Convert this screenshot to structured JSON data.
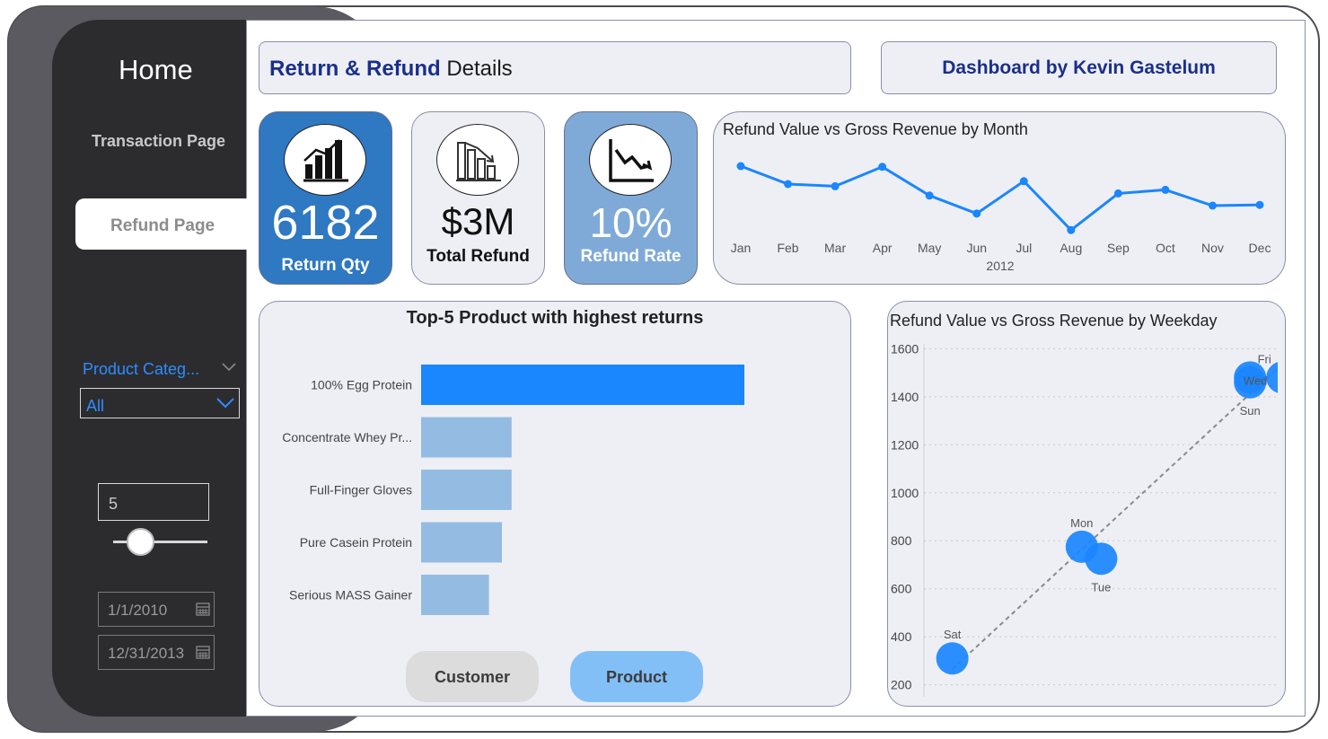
{
  "nav": {
    "home": "Home",
    "transaction": "Transaction Page",
    "refund": "Refund Page"
  },
  "filters": {
    "category_title": "Product Categ...",
    "category_value": "All",
    "top_n": "5",
    "top_n_slider_fraction": 0.15,
    "date_start": "1/1/2010",
    "date_end": "12/31/2013"
  },
  "header": {
    "title_bold": "Return & Refund",
    "title_rest": " Details",
    "byline": "Dashboard by Kevin Gastelum"
  },
  "kpis": [
    {
      "value": "6182",
      "label": "Return Qty",
      "icon": "bar-chart-icon"
    },
    {
      "value": "$3M",
      "label": "Total Refund",
      "icon": "declining-bars-icon"
    },
    {
      "value": "10%",
      "label": "Refund Rate",
      "icon": "downtrend-icon"
    }
  ],
  "toggles": {
    "customer": "Customer",
    "product": "Product"
  },
  "colors": {
    "accent": "#1a86ff",
    "bar_muted": "#94bce2",
    "navy": "#1a2f8c",
    "sidebar": "#2c2c2e"
  },
  "chart_data": [
    {
      "type": "line",
      "title": "Refund Value vs Gross Revenue by Month",
      "x": [
        "Jan",
        "Feb",
        "Mar",
        "Apr",
        "May",
        "Jun",
        "Jul",
        "Aug",
        "Sep",
        "Oct",
        "Nov",
        "Dec"
      ],
      "x_group_label": "2012",
      "values": [
        0.9,
        0.65,
        0.62,
        0.89,
        0.49,
        0.24,
        0.69,
        0.01,
        0.52,
        0.57,
        0.35,
        0.36
      ],
      "ylim": [
        0,
        1
      ],
      "grid": false
    },
    {
      "type": "bar",
      "title": "Top-5 Product with highest returns",
      "categories": [
        "100% Egg Protein",
        "Concentrate Whey Pr...",
        "Full-Finger Gloves",
        "Pure Casein Protein",
        "Serious MASS Gainer"
      ],
      "values": [
        100,
        28,
        28,
        25,
        21
      ],
      "highlight_index": 0
    },
    {
      "type": "scatter",
      "title": "Refund Value vs Gross Revenue by Weekday",
      "points": [
        {
          "label": "Sat",
          "x": 0.0,
          "y": 310
        },
        {
          "label": "Mon",
          "x": 0.4,
          "y": 775
        },
        {
          "label": "Tue",
          "x": 0.46,
          "y": 725
        },
        {
          "label": "Sun",
          "x": 0.92,
          "y": 1460
        },
        {
          "label": "Wed",
          "x": 0.92,
          "y": 1480
        },
        {
          "label": "Fri",
          "x": 1.02,
          "y": 1480
        }
      ],
      "yticks": [
        200,
        400,
        600,
        800,
        1000,
        1200,
        1400,
        1600
      ],
      "ylim": [
        180,
        1620
      ],
      "xlim": [
        -0.06,
        1.0
      ],
      "trendline": true,
      "grid": true
    }
  ]
}
